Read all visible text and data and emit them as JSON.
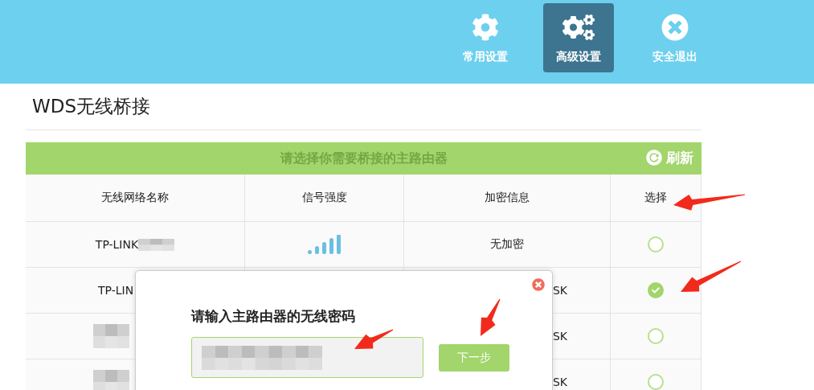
{
  "nav": [
    {
      "label": "常用设置",
      "kind": "gear",
      "selected": false
    },
    {
      "label": "高级设置",
      "kind": "gears",
      "selected": true
    },
    {
      "label": "安全退出",
      "kind": "exit",
      "selected": false
    }
  ],
  "page_title": "WDS无线桥接",
  "table": {
    "caption": "请选择你需要桥接的主路由器",
    "refresh": "刷新",
    "columns": [
      "无线网络名称",
      "信号强度",
      "加密信息",
      "选择"
    ],
    "rows": [
      {
        "name": "TP-LINK",
        "encryption": "无加密",
        "selected": false
      },
      {
        "name": "TP-LIN",
        "encryption": "SK",
        "selected": true
      },
      {
        "encryption": "SK",
        "selected": false
      },
      {
        "encryption": "SK",
        "selected": false
      }
    ]
  },
  "dialog": {
    "title": "请输入主路由器的无线密码",
    "button": "下一步"
  }
}
